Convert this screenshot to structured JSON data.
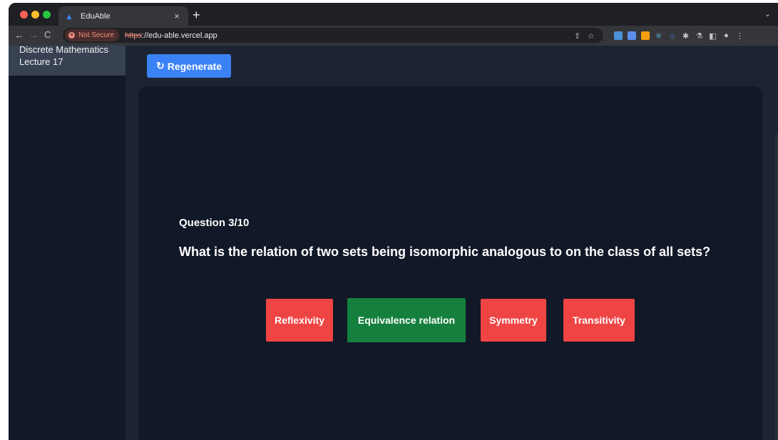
{
  "browser": {
    "tab_title": "EduAble",
    "new_tab_symbol": "+",
    "close_symbol": "×",
    "security_label": "Not Secure",
    "url_scheme": "https",
    "url_rest": "://edu-able.vercel.app"
  },
  "sidebar": {
    "items": [
      {
        "line1": "Discrete Mathematics",
        "line2": "Lecture 17"
      }
    ]
  },
  "toolbar": {
    "regenerate_label": "Regenerate"
  },
  "quiz": {
    "counter": "Question 3/10",
    "question": "What is the relation of two sets being isomorphic analogous to on the class of all sets?",
    "answers": [
      {
        "label": "Reflexivity",
        "status": "incorrect",
        "color": "#ef4444"
      },
      {
        "label": "Equivalence relation",
        "status": "correct",
        "color": "#15803d"
      },
      {
        "label": "Symmetry",
        "status": "incorrect",
        "color": "#ef4444"
      },
      {
        "label": "Transitivity",
        "status": "incorrect",
        "color": "#ef4444"
      }
    ]
  },
  "colors": {
    "accent": "#3b82f6",
    "page_bg": "#1c2433",
    "card_bg": "#111827"
  },
  "icons": {
    "regenerate": "refresh-icon",
    "security": "warning-icon"
  }
}
